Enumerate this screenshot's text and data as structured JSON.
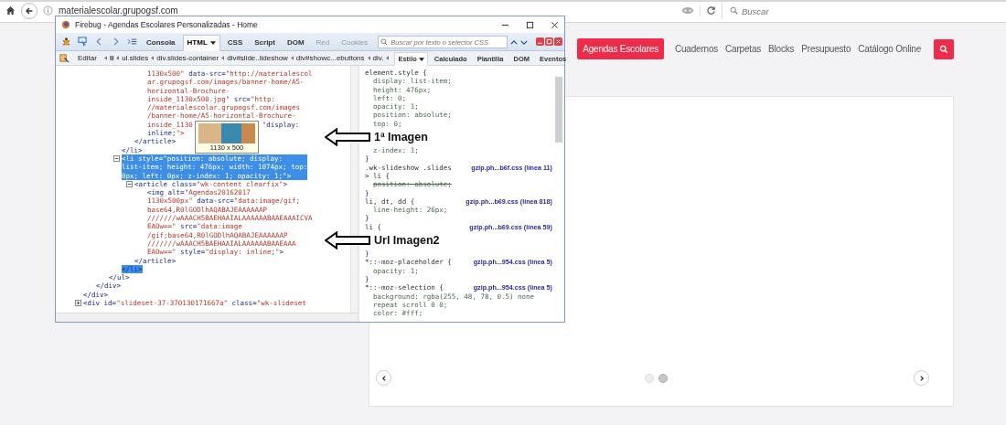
{
  "browser": {
    "url": "materialescolar.grupogsf.com",
    "search_placeholder": "Buscar"
  },
  "site_nav": {
    "items": [
      {
        "label": "Agendas Escolares",
        "selected": true
      },
      {
        "label": "Cuadernos",
        "selected": false
      },
      {
        "label": "Carpetas",
        "selected": false
      },
      {
        "label": "Blocks",
        "selected": false
      },
      {
        "label": "Presupuesto",
        "selected": false
      },
      {
        "label": "Catálogo Online",
        "selected": false
      }
    ]
  },
  "slideshow": {
    "dots": [
      {
        "selected": false
      },
      {
        "selected": true
      }
    ]
  },
  "firebug": {
    "title": "Firebug - Agendas Escolares Personalizadas - Home",
    "panels": [
      {
        "label": "Consola",
        "selected": false,
        "disabled": false,
        "menu": false
      },
      {
        "label": "HTML",
        "selected": true,
        "disabled": false,
        "menu": true
      },
      {
        "label": "CSS",
        "selected": false,
        "disabled": false,
        "menu": false
      },
      {
        "label": "Script",
        "selected": false,
        "disabled": false,
        "menu": false
      },
      {
        "label": "DOM",
        "selected": false,
        "disabled": false,
        "menu": false
      },
      {
        "label": "Red",
        "selected": false,
        "disabled": true,
        "menu": false
      },
      {
        "label": "Cookies",
        "selected": false,
        "disabled": true,
        "menu": false
      }
    ],
    "search_placeholder": "Buscar por texto o selector CSS",
    "edit_button": "Editar",
    "breadcrumbs": [
      {
        "label": "li",
        "selected": true
      },
      {
        "label": "ul.slides",
        "selected": false
      },
      {
        "label": "div.slides-container",
        "selected": false
      },
      {
        "label": "div#slide..lideshow",
        "selected": false
      },
      {
        "label": "div#showc...ebuttons",
        "selected": false
      },
      {
        "label": "div.",
        "selected": false
      }
    ],
    "side_tabs": [
      {
        "label": "Estilo",
        "selected": true,
        "menu": true
      },
      {
        "label": "Calculado",
        "selected": false,
        "menu": false
      },
      {
        "label": "Plantilla",
        "selected": false,
        "menu": false
      },
      {
        "label": "DOM",
        "selected": false,
        "menu": false
      },
      {
        "label": "Eventos",
        "selected": false,
        "menu": false
      }
    ],
    "html_tree": [
      {
        "selected": false,
        "close": "</div>",
        "children": [
          {
            "selected": false,
            "close": "</div>",
            "children": [
              {
                "selected": false,
                "close": "</ul>",
                "children": [
                  {
                    "selected": false,
                    "close": "</li>",
                    "children": [
                      {
                        "selected": false,
                        "close": "</article>",
                        "children": [
                          {
                            "selected": false,
                            "open": [
                              "1130x500\" data-src=\"http://materialescol",
                              "ar.grupogsf.com/images/banner-home/A5-",
                              "horizontal-Brochure-",
                              "inside_1130x500.jpg\" src=\"http:",
                              "//materialescolar.grupogsf.com/images",
                              "/banner-home/A5-horizontal-Brochure-",
                              [
                                "inside_1130",
                                "\"display:"
                              ],
                              "inline;\">"
                            ]
                          }
                        ]
                      }
                    ]
                  },
                  {
                    "selected": true,
                    "expanded": true,
                    "open": [
                      "<li style=\"position: absolute; display:",
                      "list-item; height: 476px; width: 1074px; top:",
                      "0px; left: 0px; z-index: 1; opacity: 1;\">"
                    ],
                    "close": "</li>",
                    "children": [
                      {
                        "selected": false,
                        "expanded": true,
                        "open": [
                          "<article class=\"wk-content clearfix\">"
                        ],
                        "close": "</article>",
                        "children": [
                          {
                            "selected": false,
                            "open": [
                              "<img alt=\"Agendas20162017",
                              "1130x500px\" data-src=\"data:image/gif;",
                              "base64,R0lGODlhAQABAJEAAAAAAP",
                              "///////wAAACH5BAEHAAIALAAAAAABAAEAAAICVA",
                              "EAOw==\" src=\"data:image",
                              "/gif;base64,R0lGODlhAQABAJEAAAAAAP",
                              "///////wAAACH5BAEHAAIALAAAAAABAAEAAA",
                              "EAOw==\" style=\"display: inline;\">"
                            ]
                          }
                        ]
                      }
                    ]
                  }
                ]
              }
            ]
          }
        ]
      },
      {
        "selected": false,
        "expanded": false,
        "open": [
          "<div id=\"slideset-37-370130171667a\" class=\"wk-slideset"
        ]
      }
    ],
    "tooltip": {
      "caption": "1130 x 500"
    },
    "css_rules": [
      {
        "selector": "element.style {",
        "close": "}",
        "props": [
          {
            "kind": "declaration",
            "text": "display: list-item;",
            "overridden": false
          },
          {
            "kind": "declaration",
            "text": "height: 476px;",
            "overridden": false
          },
          {
            "kind": "declaration",
            "text": "left: 0;",
            "overridden": false
          },
          {
            "kind": "declaration",
            "text": "opacity: 1;",
            "overridden": false
          },
          {
            "kind": "declaration",
            "text": "position: absolute;",
            "overridden": false
          },
          {
            "kind": "declaration",
            "text": "top: 0;",
            "overridden": false
          },
          {
            "kind": "note",
            "text": "1ª Imagen"
          },
          {
            "kind": "declaration",
            "text": "z-index: 1;",
            "overridden": false
          }
        ]
      },
      {
        "selector": ".wk-slideshow .slides > li {",
        "source": "gzip.ph...b6f.css (línea 11)",
        "close": "}",
        "props": [
          {
            "kind": "declaration",
            "text": "position: absolute;",
            "overridden": true
          }
        ]
      },
      {
        "selector": "li, dt, dd {",
        "source": "gzip.ph...b69.css (línea 818)",
        "close": "}",
        "props": [
          {
            "kind": "declaration",
            "text": "line-height: 26px;",
            "overridden": false
          }
        ]
      },
      {
        "selector": "li {",
        "source": "gzip.ph...b69.css (línea 59)",
        "close": "}",
        "props": [
          {
            "kind": "note",
            "text": "Url Imagen2"
          }
        ]
      },
      {
        "selector": "*::-moz-placeholder {",
        "source": "gzip.ph...954.css (línea 5)",
        "close": "}",
        "props": [
          {
            "kind": "declaration",
            "text": "opacity: 1;",
            "overridden": false
          }
        ]
      },
      {
        "selector": "*::-moz-selection {",
        "source": "gzip.ph...954.css (línea 5)",
        "props": [
          {
            "kind": "declaration",
            "text": "background: rgba(255, 48, 78, 0.5) none repeat scroll 0 0;",
            "overridden": false
          },
          {
            "kind": "declaration",
            "text": "color: #fff;",
            "overridden": false
          }
        ]
      }
    ]
  }
}
